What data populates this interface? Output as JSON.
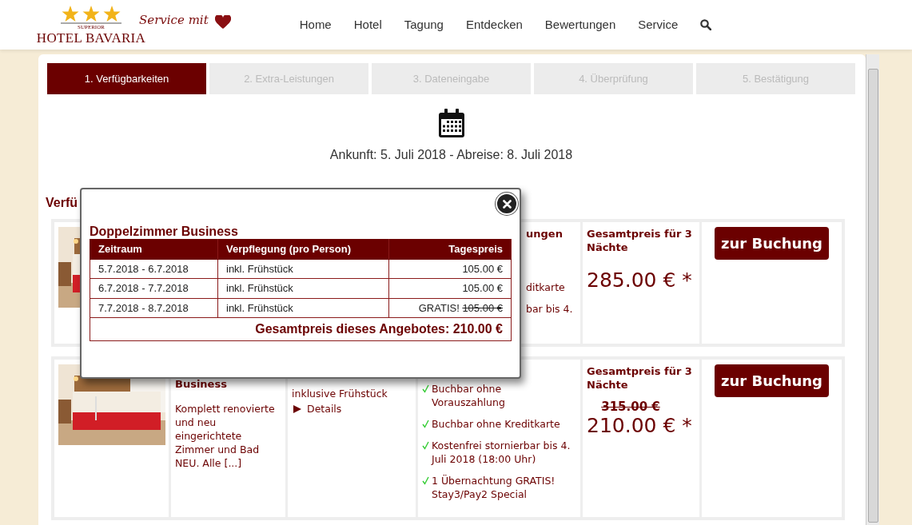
{
  "header": {
    "logo": {
      "badge": "SUPERIOR",
      "name": "HOTEL BAVARIA",
      "slogan": "Service mit"
    },
    "nav": [
      {
        "label": "Home"
      },
      {
        "label": "Hotel"
      },
      {
        "label": "Tagung"
      },
      {
        "label": "Entdecken"
      },
      {
        "label": "Bewertungen"
      },
      {
        "label": "Service"
      }
    ]
  },
  "steps": [
    {
      "label": "1. Verfügbarkeiten",
      "selected": true
    },
    {
      "label": "2. Extra-Leistungen",
      "selected": false
    },
    {
      "label": "3. Dateneingabe",
      "selected": false
    },
    {
      "label": "4. Überprüfung",
      "selected": false
    },
    {
      "label": "5. Bestätigung",
      "selected": false
    }
  ],
  "arrival": "Ankunft: 5. Juli 2018 - Abreise: 8. Juli 2018",
  "section_heading": "Verfü",
  "rooms": [
    {
      "rules_heading": "ungen",
      "rules": [
        "ditkarte",
        "bar bis 4."
      ],
      "total_heading": "Gesamtpreis für 3 Nächte",
      "price": "285.00 € *",
      "button": "zur Buchung"
    },
    {
      "title": "Business",
      "description": "Komplett renovierte und neu eingerichtete Zimmer und Bad NEU. Alle [...]",
      "board": "inklusive Frühstück",
      "details": "Details",
      "rules": [
        "Buchbar ohne Vorauszahlung",
        "Buchbar ohne Kreditkarte",
        "Kostenfrei stornierbar bis 4. Juli 2018 (18:00 Uhr)",
        "1 Übernachtung GRATIS! Stay3/Pay2 Special"
      ],
      "total_heading": "Gesamtpreis für 3 Nächte",
      "old_price": "315.00 €",
      "price": "210.00 € *",
      "button": "zur Buchung"
    }
  ],
  "modal": {
    "title": "Doppelzimmer Business",
    "columns": [
      "Zeitraum",
      "Verpflegung (pro Person)",
      "Tagespreis"
    ],
    "rows": [
      {
        "period": "5.7.2018 - 6.7.2018",
        "board": "inkl. Frühstück",
        "price": "105.00 €",
        "free": false
      },
      {
        "period": "6.7.2018 - 7.7.2018",
        "board": "inkl. Frühstück",
        "price": "105.00 €",
        "free": false
      },
      {
        "period": "7.7.2018 - 8.7.2018",
        "board": "inkl. Frühstück",
        "note": "GRATIS!",
        "price": "105.00 €",
        "free": true
      }
    ],
    "total": "Gesamtpreis dieses Angebotes: 210.00 €"
  }
}
